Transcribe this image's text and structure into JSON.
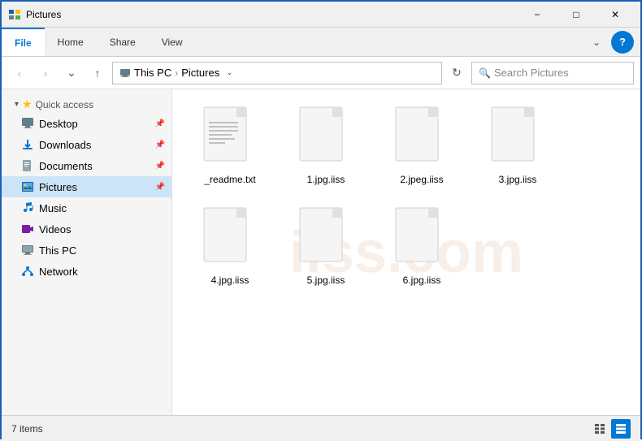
{
  "titlebar": {
    "title": "Pictures",
    "minimize_label": "−",
    "maximize_label": "□",
    "close_label": "✕"
  },
  "ribbon": {
    "tabs": [
      "File",
      "Home",
      "Share",
      "View"
    ],
    "active_tab": "File",
    "chevron": "⌄",
    "help": "?"
  },
  "addressbar": {
    "back_btn": "‹",
    "forward_btn": "›",
    "up_btn": "↑",
    "path_parts": [
      "This PC",
      "Pictures"
    ],
    "dropdown": "⌄",
    "refresh": "↻",
    "search_placeholder": "Search Pictures",
    "search_icon": "🔍"
  },
  "sidebar": {
    "sections": [
      {
        "header": "Quick access",
        "items": [
          {
            "label": "Desktop",
            "icon": "desktop",
            "pinned": true
          },
          {
            "label": "Downloads",
            "icon": "downloads",
            "pinned": true
          },
          {
            "label": "Documents",
            "icon": "documents",
            "pinned": true
          },
          {
            "label": "Pictures",
            "icon": "pictures",
            "pinned": true,
            "active": true
          }
        ]
      },
      {
        "header": "",
        "items": [
          {
            "label": "Music",
            "icon": "music",
            "pinned": false
          },
          {
            "label": "Videos",
            "icon": "videos",
            "pinned": false
          }
        ]
      },
      {
        "header": "",
        "items": [
          {
            "label": "This PC",
            "icon": "thispc",
            "pinned": false
          }
        ]
      },
      {
        "header": "",
        "items": [
          {
            "label": "Network",
            "icon": "network",
            "pinned": false
          }
        ]
      }
    ]
  },
  "files": [
    {
      "name": "_readme.txt",
      "type": "txt"
    },
    {
      "name": "1.jpg.iiss",
      "type": "iiss"
    },
    {
      "name": "2.jpeg.iiss",
      "type": "iiss"
    },
    {
      "name": "3.jpg.iiss",
      "type": "iiss"
    },
    {
      "name": "4.jpg.iiss",
      "type": "iiss"
    },
    {
      "name": "5.jpg.iiss",
      "type": "iiss"
    },
    {
      "name": "6.jpg.iiss",
      "type": "iiss"
    }
  ],
  "statusbar": {
    "item_count": "7 items",
    "view_list_icon": "≡",
    "view_grid_icon": "⊞"
  },
  "watermark": "iiss.com"
}
